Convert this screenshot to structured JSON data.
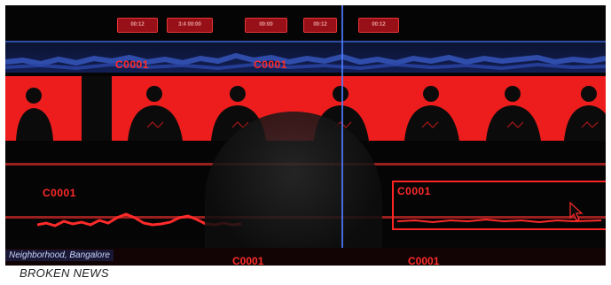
{
  "timeline": {
    "markers": [
      "00:12",
      "3:4 00:00",
      "00:00",
      "00:12",
      "00:12"
    ],
    "clip_labels": [
      "C0001",
      "C0001",
      "C0001",
      "C0001",
      "C0001",
      "C0001"
    ]
  },
  "overlay": {
    "location": "Neighborhood, Bangalore"
  },
  "caption": {
    "title": "BROKEN NEWS"
  },
  "colors": {
    "accent": "#ee1d1d",
    "playhead": "#4f7bff",
    "background": "#050505"
  },
  "icons": [
    "cursor-arrow-icon",
    "playhead-icon"
  ]
}
